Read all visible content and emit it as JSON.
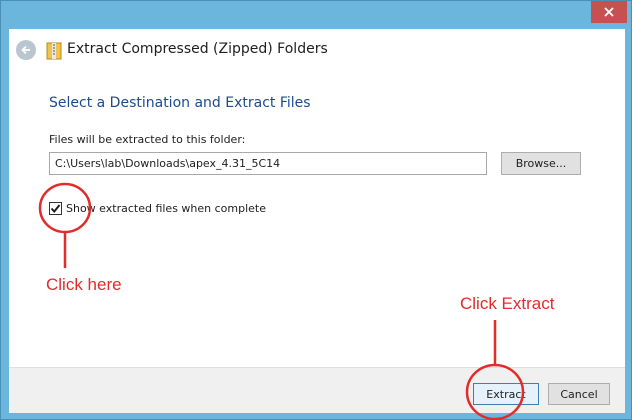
{
  "window": {
    "title": "Extract Compressed (Zipped) Folders",
    "close_icon": "close-icon",
    "back_icon": "back-arrow-icon",
    "folder_icon": "zip-folder-icon"
  },
  "main": {
    "section_title": "Select a Destination and Extract Files",
    "path_label": "Files will be extracted to this folder:",
    "path_value": "C:\\Users\\lab\\Downloads\\apex_4.31_5C14",
    "browse_label": "Browse...",
    "show_files_checked": true,
    "show_files_label": "Show extracted files when complete"
  },
  "footer": {
    "extract_label": "Extract",
    "cancel_label": "Cancel"
  },
  "annotations": {
    "click_here": "Click here",
    "click_extract": "Click Extract",
    "color": "#e22b2b"
  },
  "colors": {
    "title_bar": "#6bb6dc",
    "close_button": "#c75050",
    "heading_blue": "#1c4b8f"
  }
}
